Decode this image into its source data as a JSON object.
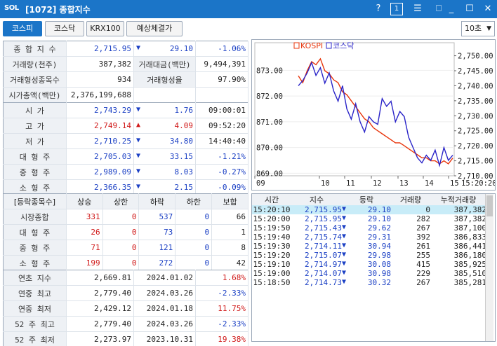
{
  "window": {
    "logo": "SOL",
    "title": "[1072] 종합지수",
    "help": "?",
    "num": "1",
    "menu": "☰",
    "pin": "⎕",
    "min": "_",
    "max": "☐",
    "close": "✕"
  },
  "tabs": [
    {
      "label": "코스피",
      "active": true
    },
    {
      "label": "코스닥",
      "active": false
    },
    {
      "label": "KRX100",
      "active": false
    },
    {
      "label": "예상체결가",
      "active": false
    }
  ],
  "interval": "10초",
  "summary": {
    "index_label": "종 합 지 수",
    "index_value": "2,715.95",
    "change": "29.10",
    "change_pct": "-1.06%",
    "vol_label": "거래량(천주)",
    "vol": "387,382",
    "amt_label": "거래대금(백만)",
    "amt": "9,494,391",
    "form_cnt_label": "거래형성종목수",
    "form_cnt": "934",
    "form_rate_label": "거래형성율",
    "form_rate": "97.90%",
    "mcap_label": "시가총액(백만)",
    "mcap": "2,376,199,688"
  },
  "ohlc": [
    {
      "label": "시     가",
      "value": "2,743.29",
      "dir": "dn",
      "chg": "1.76",
      "extra": "09:00:01",
      "vcol": "blue",
      "ecol": ""
    },
    {
      "label": "고     가",
      "value": "2,749.14",
      "dir": "up",
      "chg": "4.09",
      "extra": "09:52:20",
      "vcol": "red",
      "ecol": ""
    },
    {
      "label": "저     가",
      "value": "2,710.25",
      "dir": "dn",
      "chg": "34.80",
      "extra": "14:40:40",
      "vcol": "blue",
      "ecol": ""
    },
    {
      "label": "대 형 주",
      "value": "2,705.03",
      "dir": "dn",
      "chg": "33.15",
      "extra": "-1.21%",
      "vcol": "blue",
      "ecol": "blue"
    },
    {
      "label": "중 형 주",
      "value": "2,989.09",
      "dir": "dn",
      "chg": "8.03",
      "extra": "-0.27%",
      "vcol": "blue",
      "ecol": "blue"
    },
    {
      "label": "소 형 주",
      "value": "2,366.35",
      "dir": "dn",
      "chg": "2.15",
      "extra": "-0.09%",
      "vcol": "blue",
      "ecol": "blue"
    }
  ],
  "breadth": {
    "headers": [
      "[등락종목수]",
      "상승",
      "상한",
      "하락",
      "하한",
      "보합"
    ],
    "rows": [
      [
        "시장종합",
        "331",
        "0",
        "537",
        "0",
        "66"
      ],
      [
        "대 형 주",
        "26",
        "0",
        "73",
        "0",
        "1"
      ],
      [
        "중 형 주",
        "71",
        "0",
        "121",
        "0",
        "8"
      ],
      [
        "소 형 주",
        "199",
        "0",
        "272",
        "0",
        "42"
      ]
    ]
  },
  "yearly": [
    {
      "label": "연초  지수",
      "value": "2,669.81",
      "date": "2024.01.02",
      "pct": "1.68%",
      "pcol": "red"
    },
    {
      "label": "연중  최고",
      "value": "2,779.40",
      "date": "2024.03.26",
      "pct": "-2.33%",
      "pcol": "blue"
    },
    {
      "label": "연중  최저",
      "value": "2,429.12",
      "date": "2024.01.18",
      "pct": "11.75%",
      "pcol": "red"
    },
    {
      "label": "52 주 최고",
      "value": "2,779.40",
      "date": "2024.03.26",
      "pct": "-2.33%",
      "pcol": "blue"
    },
    {
      "label": "52 주 최저",
      "value": "2,273.97",
      "date": "2023.10.31",
      "pct": "19.38%",
      "pcol": "red"
    }
  ],
  "ticks": {
    "headers": [
      "시간",
      "지수",
      "등락",
      "거래량",
      "누적거래량"
    ],
    "rows": [
      [
        "15:20:10",
        "2,715.95",
        "29.10",
        "0",
        "387,382"
      ],
      [
        "15:20:00",
        "2,715.95",
        "29.10",
        "282",
        "387,382"
      ],
      [
        "15:19:50",
        "2,715.43",
        "29.62",
        "267",
        "387,100"
      ],
      [
        "15:19:40",
        "2,715.74",
        "29.31",
        "392",
        "386,833"
      ],
      [
        "15:19:30",
        "2,714.11",
        "30.94",
        "261",
        "386,441"
      ],
      [
        "15:19:20",
        "2,715.07",
        "29.98",
        "255",
        "386,180"
      ],
      [
        "15:19:10",
        "2,714.97",
        "30.08",
        "415",
        "385,925"
      ],
      [
        "15:19:00",
        "2,714.07",
        "30.98",
        "229",
        "385,510"
      ],
      [
        "15:18:50",
        "2,714.73",
        "30.32",
        "267",
        "385,281"
      ]
    ]
  },
  "colors": {
    "kospi": "#e8340a",
    "kosdaq": "#2a24c8",
    "accent": "#1b75c8"
  },
  "chart_data": {
    "type": "line",
    "legend": [
      "KOSPI",
      "코스닥"
    ],
    "x_ticks": [
      "09",
      "10",
      "11",
      "12",
      "13",
      "14",
      "15",
      "15:20:20"
    ],
    "left_ticks": [
      "873.00",
      "872.00",
      "871.00",
      "870.00",
      "869.00"
    ],
    "right_ticks": [
      "2,750.00",
      "2,745.00",
      "2,740.00",
      "2,735.00",
      "2,730.00",
      "2,725.00",
      "2,720.00",
      "2,715.00",
      "2,710.00"
    ],
    "kospi_range": [
      2710,
      2752
    ],
    "kosdaq_range": [
      868.9,
      873.8
    ],
    "series": [
      {
        "name": "KOSPI",
        "axis": "right",
        "values": [
          2743.3,
          2741,
          2745,
          2748,
          2747,
          2749,
          2745,
          2744,
          2742,
          2741,
          2738,
          2737,
          2735,
          2733,
          2731,
          2729,
          2728,
          2726,
          2725,
          2724,
          2723,
          2722,
          2721,
          2721,
          2720,
          2719,
          2718,
          2717,
          2716,
          2716,
          2715,
          2715,
          2714,
          2715,
          2714,
          2715.9
        ]
      },
      {
        "name": "코스닥",
        "axis": "left",
        "values": [
          872.4,
          872.6,
          872.9,
          873.3,
          872.8,
          873.1,
          872.5,
          872.9,
          872.2,
          871.8,
          872.4,
          871.5,
          871.1,
          871.7,
          871.0,
          870.6,
          871.2,
          871.0,
          870.9,
          871.9,
          871.6,
          871.8,
          871.0,
          871.4,
          871.2,
          870.4,
          870.0,
          869.6,
          869.4,
          869.7,
          869.5,
          869.9,
          869.3,
          870.0,
          869.5,
          869.7
        ]
      }
    ]
  }
}
